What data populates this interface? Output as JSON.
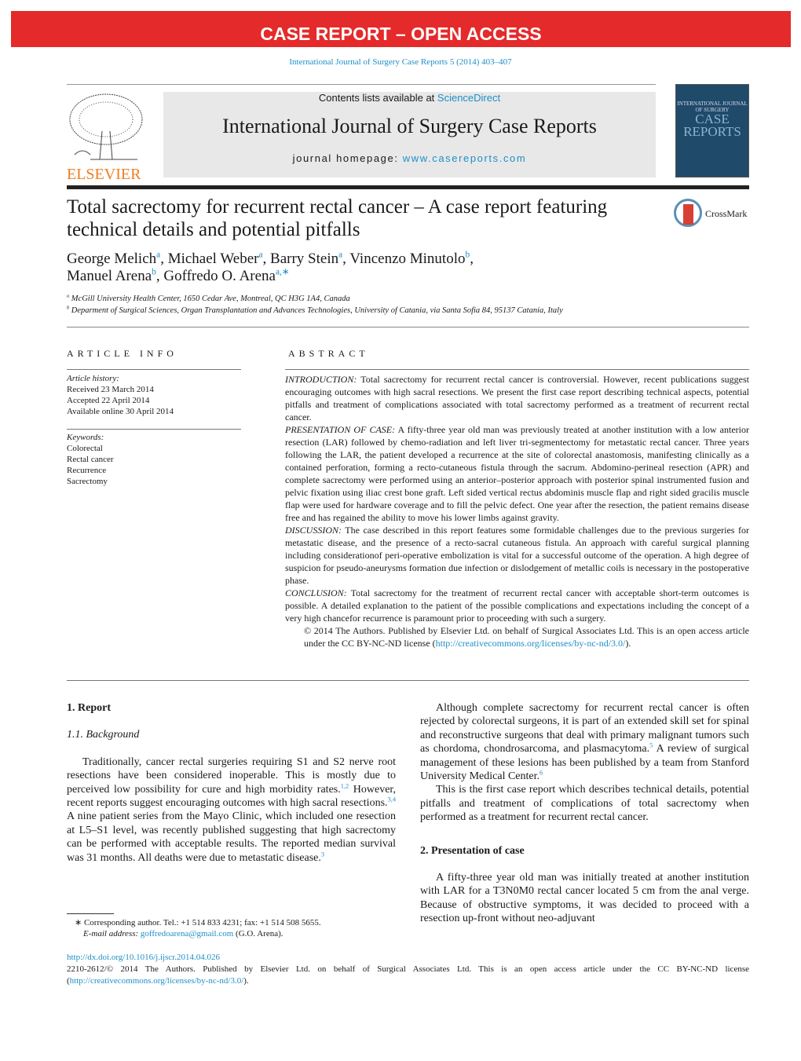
{
  "banner": "CASE REPORT – OPEN ACCESS",
  "citation": "International Journal of Surgery Case Reports 5 (2014) 403–407",
  "masthead": {
    "contents_prefix": "Contents lists available at ",
    "contents_link": "ScienceDirect",
    "journal_title": "International Journal of Surgery Case Reports",
    "homepage_prefix": "journal homepage: ",
    "homepage_link": "www.casereports.com"
  },
  "publisher_logo": "ELSEVIER",
  "cover": {
    "line1": "INTERNATIONAL JOURNAL OF SURGERY",
    "line2": "CASE",
    "line3": "REPORTS"
  },
  "crossmark": "CrossMark",
  "title": "Total sacrectomy for recurrent rectal cancer – A case report featuring technical details and potential pitfalls",
  "authors": [
    {
      "name": "George Melich",
      "aff": "a"
    },
    {
      "name": "Michael Weber",
      "aff": "a"
    },
    {
      "name": "Barry Stein",
      "aff": "a"
    },
    {
      "name": "Vincenzo Minutolo",
      "aff": "b"
    },
    {
      "name": "Manuel Arena",
      "aff": "b"
    },
    {
      "name": "Goffredo O. Arena",
      "aff": "a,∗"
    }
  ],
  "affiliations": [
    {
      "mark": "a",
      "text": "McGill University Health Center, 1650 Cedar Ave, Montreal, QC H3G 1A4, Canada"
    },
    {
      "mark": "b",
      "text": "Deparment of Surgical Sciences, Organ Transplantation and Advances Technologies, University of Catania, via Santa Sofia 84, 95137 Catania, Italy"
    }
  ],
  "article_info": {
    "heading": "ARTICLE INFO",
    "history_label": "Article history:",
    "history": [
      "Received 23 March 2014",
      "Accepted 22 April 2014",
      "Available online 30 April 2014"
    ],
    "keywords_label": "Keywords:",
    "keywords": [
      "Colorectal",
      "Rectal cancer",
      "Recurrence",
      "Sacrectomy"
    ]
  },
  "abstract": {
    "heading": "ABSTRACT",
    "sections": [
      {
        "label": "INTRODUCTION:",
        "text": " Total sacrectomy for recurrent rectal cancer is controversial. However, recent publications suggest encouraging outcomes with high sacral resections. We present the first case report describing technical aspects, potential pitfalls and treatment of complications associated with total sacrectomy performed as a treatment of recurrent rectal cancer."
      },
      {
        "label": "PRESENTATION OF CASE:",
        "text": " A fifty-three year old man was previously treated at another institution with a low anterior resection (LAR) followed by chemo-radiation and left liver tri-segmentectomy for metastatic rectal cancer. Three years following the LAR, the patient developed a recurrence at the site of colorectal anastomosis, manifesting clinically as a contained perforation, forming a recto-cutaneous fistula through the sacrum. Abdomino-perineal resection (APR) and complete sacrectomy were performed using an anterior–posterior approach with posterior spinal instrumented fusion and pelvic fixation using iliac crest bone graft. Left sided vertical rectus abdominis muscle flap and right sided gracilis muscle flap were used for hardware coverage and to fill the pelvic defect. One year after the resection, the patient remains disease free and has regained the ability to move his lower limbs against gravity."
      },
      {
        "label": "DISCUSSION:",
        "text": " The case described in this report features some formidable challenges due to the previous surgeries for metastatic disease, and the presence of a recto-sacral cutaneous fistula. An approach with careful surgical planning including considerationof peri-operative embolization is vital for a successful outcome of the operation. A high degree of suspicion for pseudo-aneurysms formation due infection or dislodgement of metallic coils is necessary in the postoperative phase."
      },
      {
        "label": "CONCLUSION:",
        "text": " Total sacrectomy for the treatment of recurrent rectal cancer with acceptable short-term outcomes is possible. A detailed explanation to the patient of the possible complications and expectations including the concept of a very high chancefor recurrence is paramount prior to proceeding with such a surgery."
      }
    ],
    "copyright_text": "© 2014 The Authors. Published by Elsevier Ltd. on behalf of Surgical Associates Ltd. This is an open access article under the CC BY-NC-ND license (",
    "copyright_link": "http://creativecommons.org/licenses/by-nc-nd/3.0/",
    "copyright_end": ")."
  },
  "body": {
    "s1_heading": "1.  Report",
    "s11_heading": "1.1.  Background",
    "p1": [
      "Traditionally, cancer rectal surgeries requiring S1 and S2 nerve root resections have been considered inoperable. This is mostly due to perceived low possibility for cure and high morbidity rates.",
      "1,2",
      " However, recent reports suggest encouraging outcomes with high sacral resections.",
      "3,4",
      " A nine patient series from the Mayo Clinic, which included one resection at L5–S1 level, was recently published suggesting that high sacrectomy can be performed with acceptable results. The reported median survival was 31 months. All deaths were due to metastatic disease.",
      "3"
    ],
    "p2": [
      "Although complete sacrectomy for recurrent rectal cancer is often rejected by colorectal surgeons, it is part of an extended skill set for spinal and reconstructive surgeons that deal with primary malignant tumors such as chordoma, chondrosarcoma, and plasmacytoma.",
      "5",
      " A review of surgical management of these lesions has been published by a team from Stanford University Medical Center.",
      "6"
    ],
    "p3": "This is the first case report which describes technical details, potential pitfalls and treatment of complications of total sacrectomy when performed as a treatment for recurrent rectal cancer.",
    "s2_heading": "2.  Presentation of case",
    "p4": "A fifty-three year old man was initially treated at another institution with LAR for a T3N0M0 rectal cancer located 5 cm from the anal verge. Because of obstructive symptoms, it was decided to proceed with a resection up-front without neo-adjuvant"
  },
  "footnote": {
    "mark": "∗",
    "text": "Corresponding author. Tel.: +1 514 833 4231; fax: +1 514 508 5655.",
    "email_label": "E-mail address:",
    "email": "goffredoarena@gmail.com",
    "email_suffix": " (G.O. Arena)."
  },
  "footer": {
    "doi": "http://dx.doi.org/10.1016/j.ijscr.2014.04.026",
    "license_text": "2210-2612/© 2014 The Authors. Published by Elsevier Ltd. on behalf of Surgical Associates Ltd. This is an open access article under the CC BY-NC-ND license (",
    "license_link": "http://creativecommons.org/licenses/by-nc-nd/3.0/",
    "license_end": ")."
  }
}
